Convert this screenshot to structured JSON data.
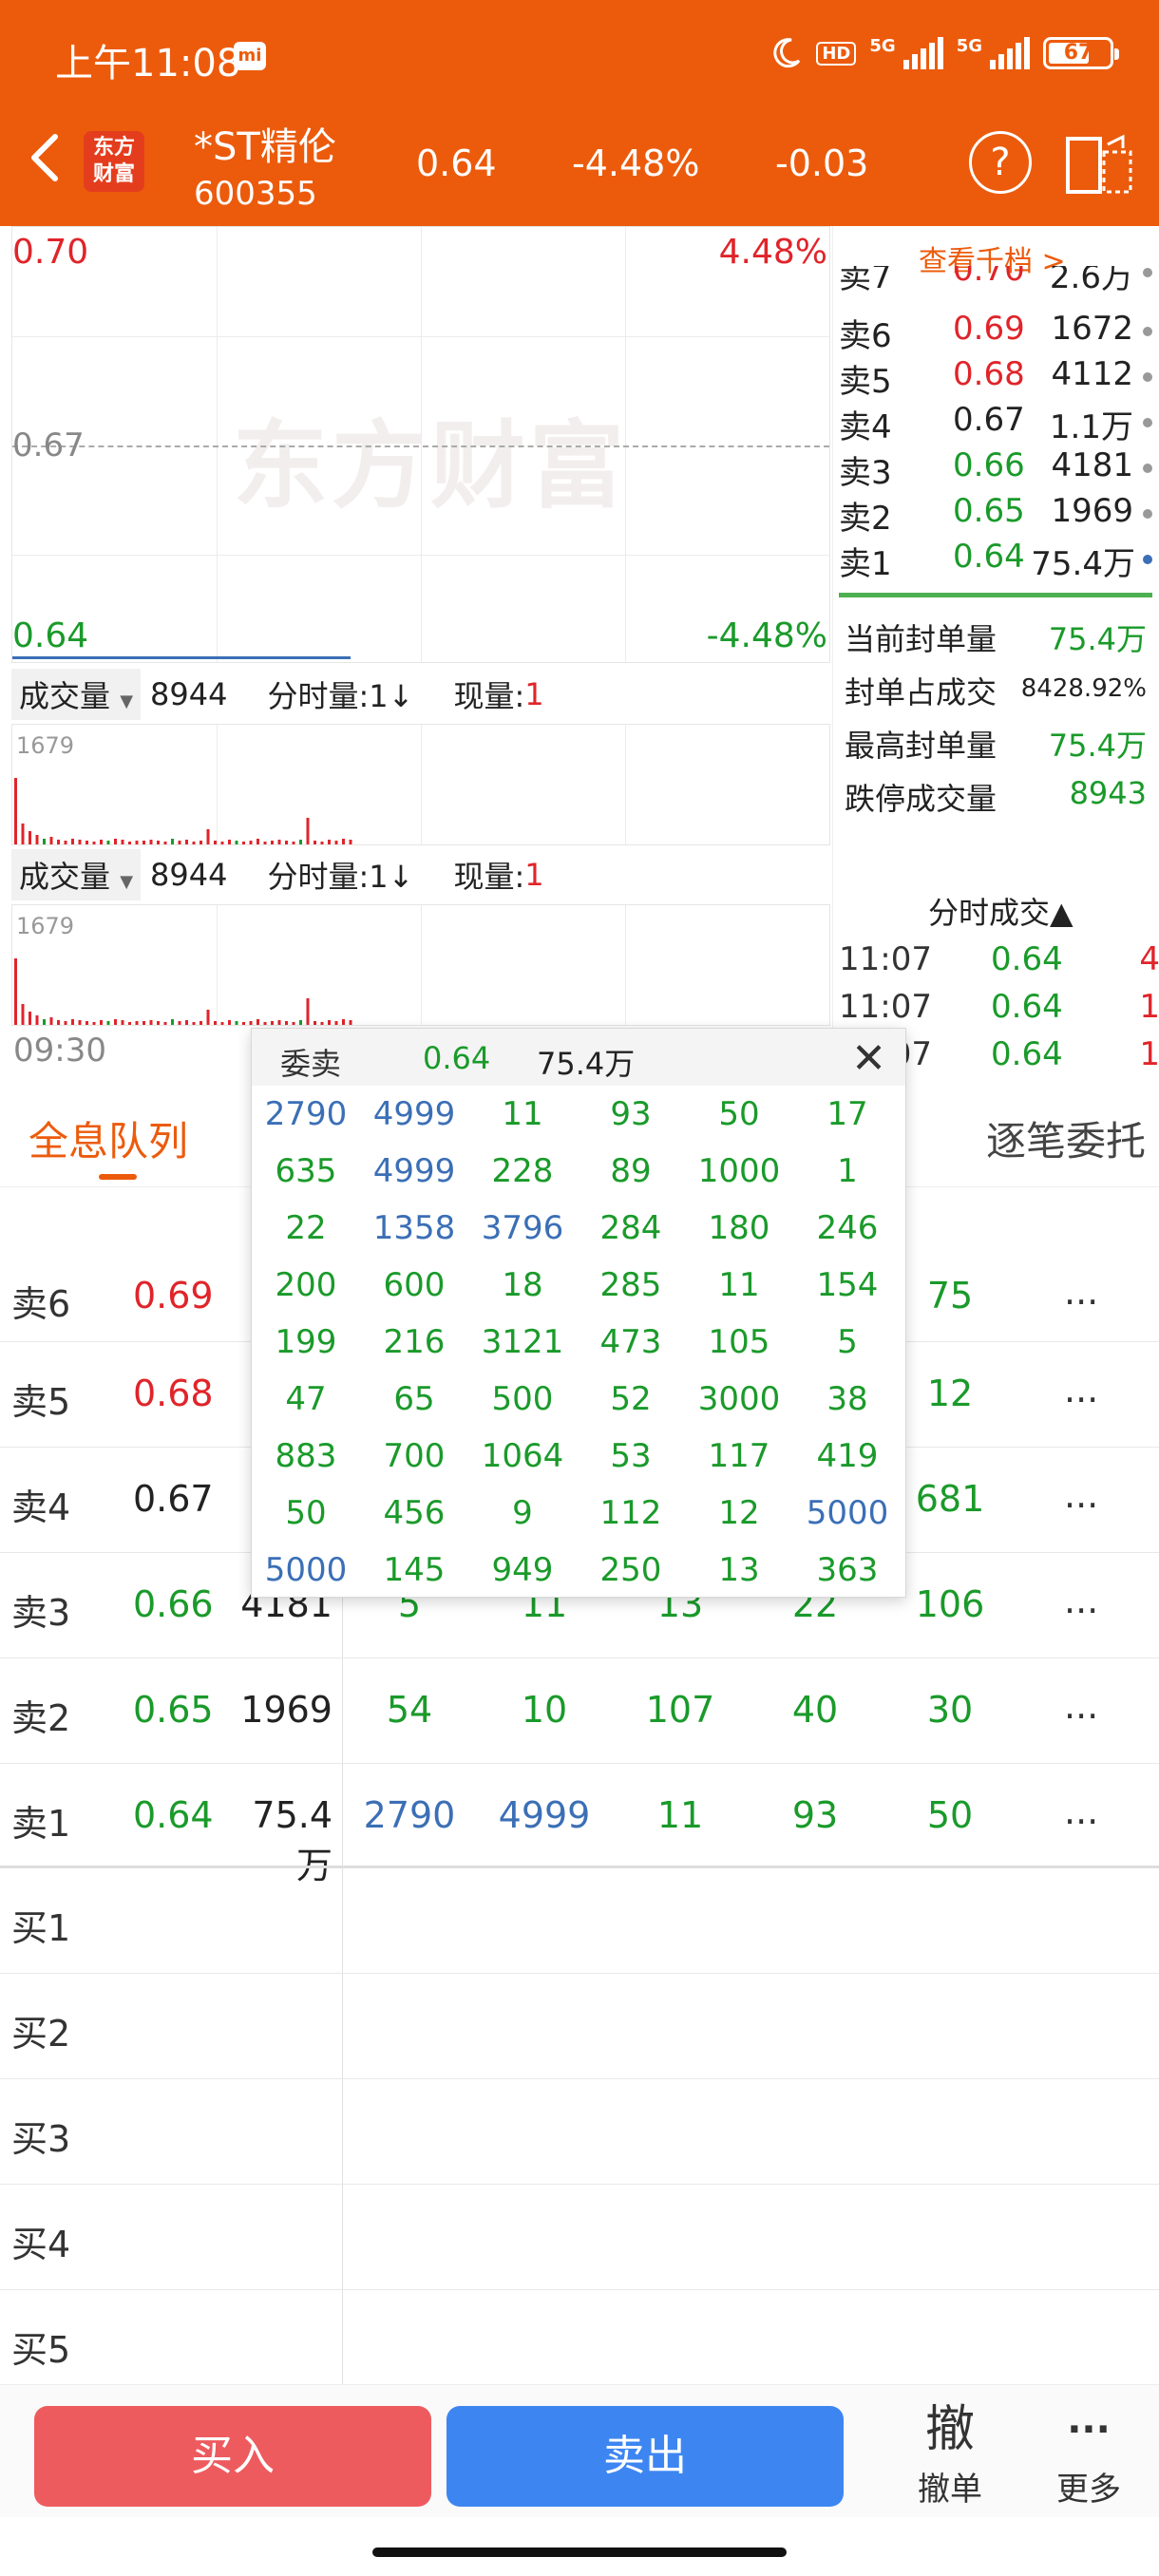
{
  "status": {
    "time": "上午11:08",
    "mi": "mi",
    "hd": "HD",
    "net1": "5G",
    "net2": "5G",
    "battery": "67"
  },
  "header": {
    "logo": "东方财富",
    "name": "*ST精伦",
    "code": "600355",
    "price": "0.64",
    "pct": "-4.48%",
    "change": "-0.03",
    "help": "?"
  },
  "chart": {
    "y_top": "0.70",
    "y_mid": "0.67",
    "y_bot": "0.64",
    "pct_top": "4.48%",
    "pct_bot": "-4.48%",
    "watermark": "东方财富",
    "time_start": "09:30",
    "panels": [
      {
        "select": "成交量",
        "value": "8944",
        "mode": "分时量:1↓",
        "now_label": "现量:",
        "now_value": "1",
        "max": "1679"
      },
      {
        "select": "成交量",
        "value": "8944",
        "mode": "分时量:1↓",
        "now_label": "现量:",
        "now_value": "1",
        "max": "1679"
      }
    ]
  },
  "order_book": {
    "view_more": "查看千档 >",
    "asks": [
      {
        "label": "卖7",
        "price": "0.70",
        "volume": "2.6万"
      },
      {
        "label": "卖6",
        "price": "0.69",
        "volume": "1672"
      },
      {
        "label": "卖5",
        "price": "0.68",
        "volume": "4112"
      },
      {
        "label": "卖4",
        "price": "0.67",
        "volume": "1.1万"
      },
      {
        "label": "卖3",
        "price": "0.66",
        "volume": "4181"
      },
      {
        "label": "卖2",
        "price": "0.65",
        "volume": "1969"
      },
      {
        "label": "卖1",
        "price": "0.64",
        "volume": "75.4万"
      }
    ],
    "stats": [
      {
        "label": "当前封单量",
        "value": "75.4万"
      },
      {
        "label": "封单占成交",
        "value": "8428.92%"
      },
      {
        "label": "最高封单量",
        "value": "75.4万"
      },
      {
        "label": "跌停成交量",
        "value": "8943"
      }
    ],
    "ticks_header": "分时成交▲",
    "ticks": [
      {
        "time": "11:07",
        "price": "0.64",
        "qty": "4"
      },
      {
        "time": "11:07",
        "price": "0.64",
        "qty": "1"
      },
      {
        "time": "11:07",
        "price": "0.64",
        "qty": "1"
      }
    ]
  },
  "tabs": {
    "queue": "全息队列",
    "by_order": "逐笔委托"
  },
  "queue": {
    "sell_rows": [
      {
        "label": "卖6",
        "price": "0.69",
        "total": "",
        "cells": [
          "",
          "",
          "",
          "",
          "75"
        ]
      },
      {
        "label": "卖5",
        "price": "0.68",
        "total": "",
        "cells": [
          "",
          "",
          "",
          "",
          "12"
        ]
      },
      {
        "label": "卖4",
        "price": "0.67",
        "total": "",
        "cells": [
          "",
          "",
          "",
          "",
          "681"
        ]
      },
      {
        "label": "卖3",
        "price": "0.66",
        "total": "4181",
        "cells": [
          "5",
          "11",
          "13",
          "22",
          "106"
        ]
      },
      {
        "label": "卖2",
        "price": "0.65",
        "total": "1969",
        "cells": [
          "54",
          "10",
          "107",
          "40",
          "30"
        ]
      },
      {
        "label": "卖1",
        "price": "0.64",
        "total": "75.4万",
        "cells": [
          "2790",
          "4999",
          "11",
          "93",
          "50"
        ]
      }
    ],
    "buy_rows": [
      {
        "label": "买1"
      },
      {
        "label": "买2"
      },
      {
        "label": "买3"
      },
      {
        "label": "买4"
      },
      {
        "label": "买5"
      }
    ],
    "more": "..."
  },
  "popup": {
    "title": "委卖",
    "price": "0.64",
    "volume": "75.4万",
    "close": "✕",
    "grid": [
      [
        "2790",
        "4999",
        "11",
        "93",
        "50",
        "17"
      ],
      [
        "635",
        "4999",
        "228",
        "89",
        "1000",
        "1"
      ],
      [
        "22",
        "1358",
        "3796",
        "284",
        "180",
        "246"
      ],
      [
        "200",
        "600",
        "18",
        "285",
        "11",
        "154"
      ],
      [
        "199",
        "216",
        "3121",
        "473",
        "105",
        "5"
      ],
      [
        "47",
        "65",
        "500",
        "52",
        "3000",
        "38"
      ],
      [
        "883",
        "700",
        "1064",
        "53",
        "117",
        "419"
      ],
      [
        "50",
        "456",
        "9",
        "112",
        "12",
        "5000"
      ],
      [
        "5000",
        "145",
        "949",
        "250",
        "13",
        "363"
      ]
    ]
  },
  "bottom": {
    "buy": "买入",
    "sell": "卖出",
    "cancel_icon": "撤",
    "cancel": "撤单",
    "more_icon": "···",
    "more": "更多"
  },
  "colors": {
    "header": "#ec5b0c",
    "up": "#e0242a",
    "down": "#1a9a2a",
    "large_order": "#3b6fb6",
    "buy_button": "#ee5b5e",
    "sell_button": "#3d86f2"
  }
}
